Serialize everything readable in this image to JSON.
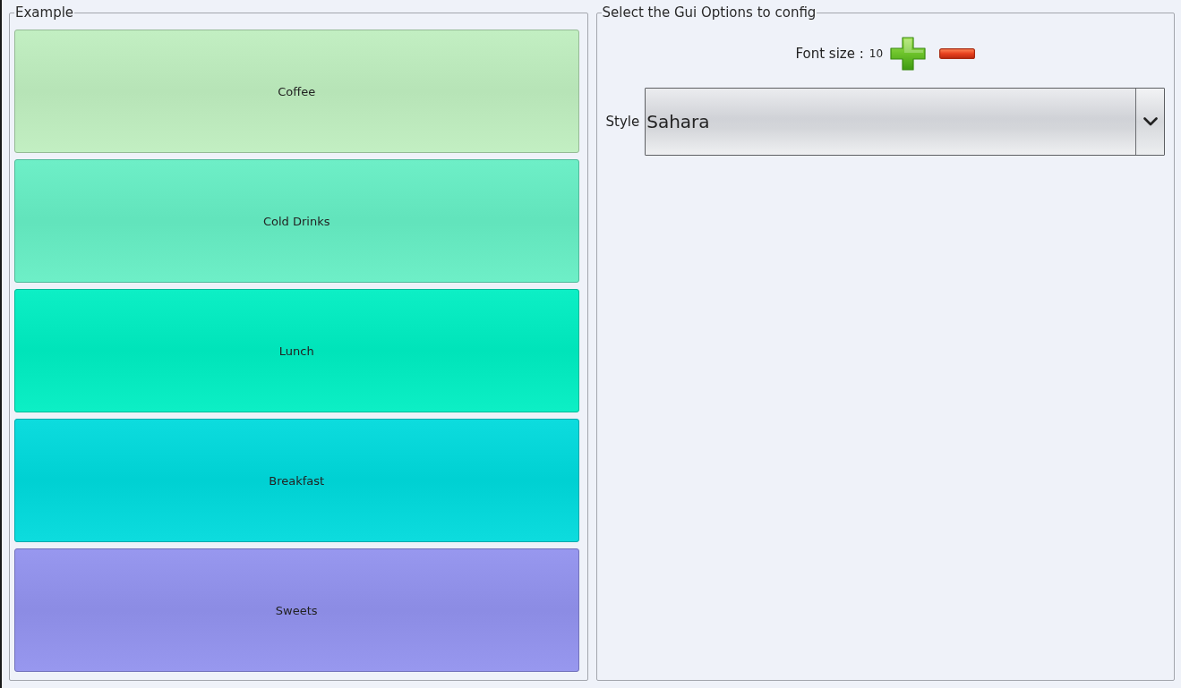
{
  "example": {
    "title": "Example",
    "buttons": [
      {
        "label": "Coffee",
        "color": "#bfeebf"
      },
      {
        "label": "Cold Drinks",
        "color": "#66eec4"
      },
      {
        "label": "Lunch",
        "color": "#00eec2"
      },
      {
        "label": "Breakfast",
        "color": "#00dadc"
      },
      {
        "label": "Sweets",
        "color": "#9292ee"
      }
    ]
  },
  "gui_options": {
    "title": "Select the Gui Options to config",
    "font_size": {
      "label": "Font size :",
      "value": "10"
    },
    "style": {
      "label": "Style",
      "value": "Sahara"
    }
  }
}
